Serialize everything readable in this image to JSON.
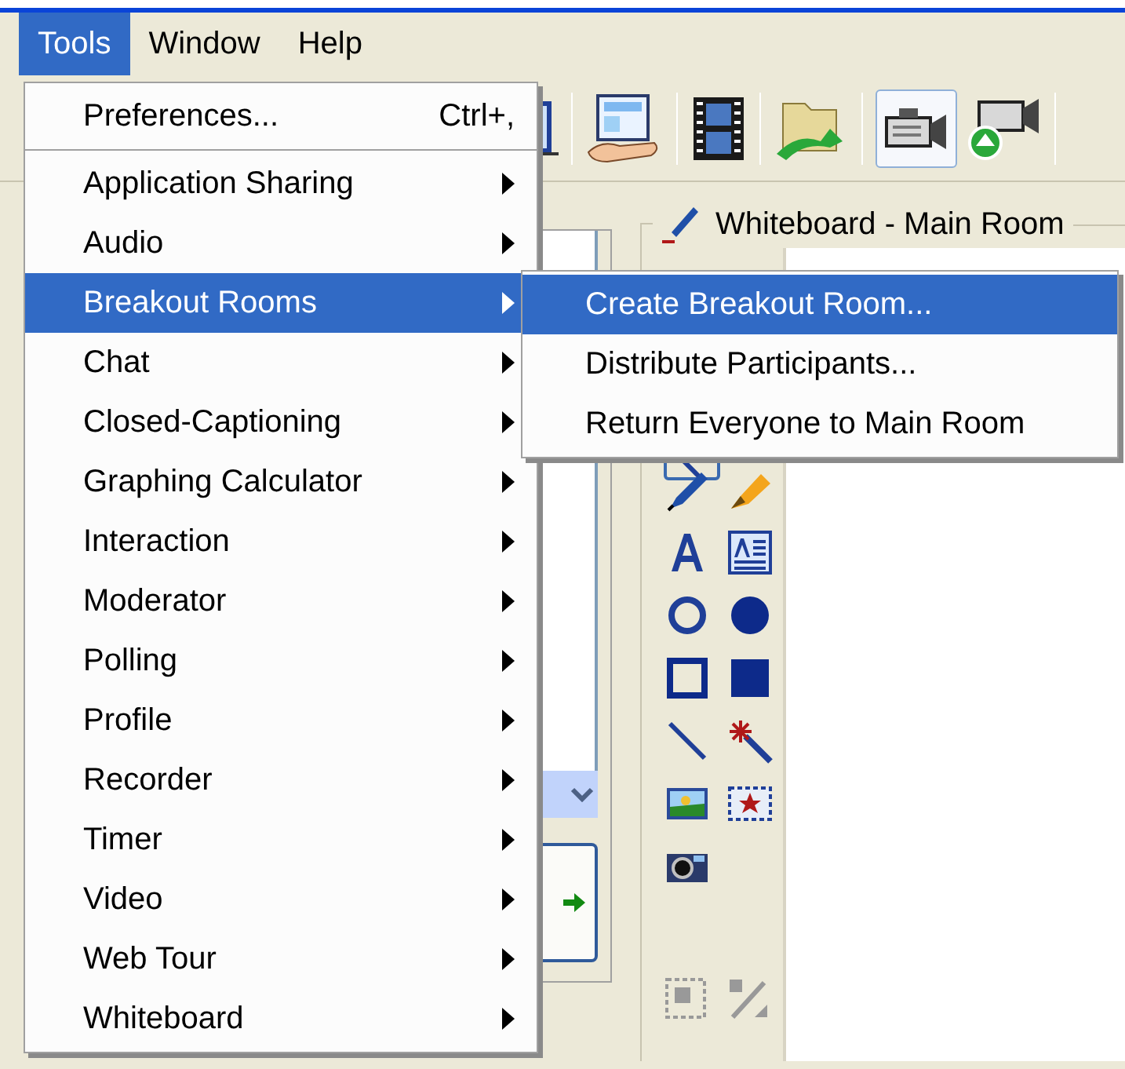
{
  "menubar": [
    {
      "label": "Tools",
      "selected": true
    },
    {
      "label": "Window",
      "selected": false
    },
    {
      "label": "Help",
      "selected": false
    }
  ],
  "tools_menu": {
    "groups": [
      [
        {
          "label": "Preferences...",
          "shortcut": "Ctrl+,",
          "kind": "command",
          "selected": false
        }
      ],
      [
        {
          "label": "Application Sharing",
          "kind": "submenu",
          "selected": false
        },
        {
          "label": "Audio",
          "kind": "submenu",
          "selected": false
        },
        {
          "label": "Breakout Rooms",
          "kind": "submenu",
          "selected": true
        },
        {
          "label": "Chat",
          "kind": "submenu",
          "selected": false
        },
        {
          "label": "Closed-Captioning",
          "kind": "submenu",
          "selected": false
        },
        {
          "label": "Graphing Calculator",
          "kind": "submenu",
          "selected": false
        },
        {
          "label": "Interaction",
          "kind": "submenu",
          "selected": false
        },
        {
          "label": "Moderator",
          "kind": "submenu",
          "selected": false
        },
        {
          "label": "Polling",
          "kind": "submenu",
          "selected": false
        },
        {
          "label": "Profile",
          "kind": "submenu",
          "selected": false
        },
        {
          "label": "Recorder",
          "kind": "submenu",
          "selected": false
        },
        {
          "label": "Timer",
          "kind": "submenu",
          "selected": false
        },
        {
          "label": "Video",
          "kind": "submenu",
          "selected": false
        },
        {
          "label": "Web Tour",
          "kind": "submenu",
          "selected": false
        },
        {
          "label": "Whiteboard",
          "kind": "submenu",
          "selected": false
        }
      ]
    ]
  },
  "breakout_submenu": [
    {
      "label": "Create Breakout Room...",
      "selected": true
    },
    {
      "label": "Distribute Participants...",
      "selected": false
    },
    {
      "label": "Return Everyone to Main Room",
      "selected": false
    }
  ],
  "whiteboard": {
    "title": "Whiteboard - Main Room"
  }
}
